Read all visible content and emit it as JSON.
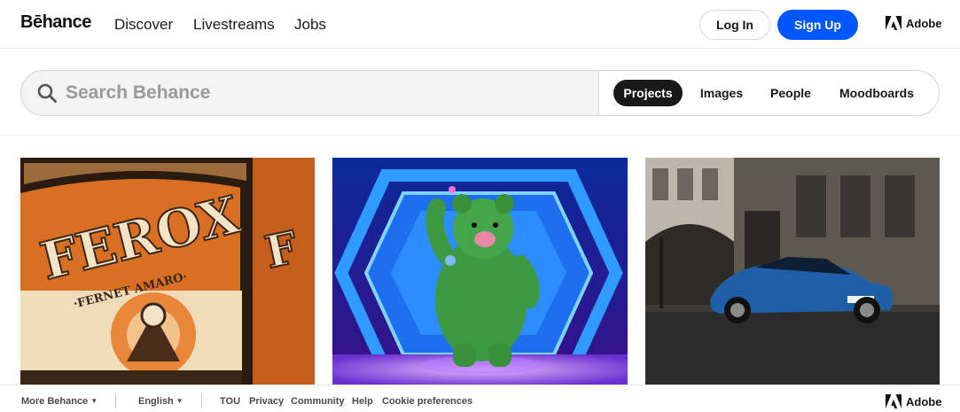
{
  "header": {
    "logo": "Bēhance",
    "nav": [
      "Discover",
      "Livestreams",
      "Jobs"
    ],
    "login_label": "Log In",
    "signup_label": "Sign Up",
    "adobe_label": "Adobe",
    "signup_color": "#0057ff"
  },
  "search": {
    "placeholder": "Search Behance",
    "value": "",
    "tabs": [
      "Projects",
      "Images",
      "People",
      "Moodboards"
    ],
    "active_tab": "Projects"
  },
  "gallery": {
    "projects": [
      {
        "description": "FEROX fernet amaro bottle label illustration",
        "brand_text": "FEROX",
        "sub_text": "·FERNET AMARO·",
        "palette": [
          "#e07b2a",
          "#3a2718",
          "#f4e3c6"
        ]
      },
      {
        "description": "Green fuzzy bear waving on neon stage",
        "palette": [
          "#1f6df0",
          "#3c9a3e",
          "#0a1a6a"
        ]
      },
      {
        "description": "Blue sports car parked on city street",
        "palette": [
          "#2a2a2a",
          "#1f5fa8",
          "#6f6a63"
        ]
      }
    ]
  },
  "footer": {
    "more": "More Behance",
    "language": "English",
    "links": [
      "TOU",
      "Privacy",
      "Community",
      "Help",
      "Cookie preferences"
    ],
    "adobe_label": "Adobe"
  }
}
